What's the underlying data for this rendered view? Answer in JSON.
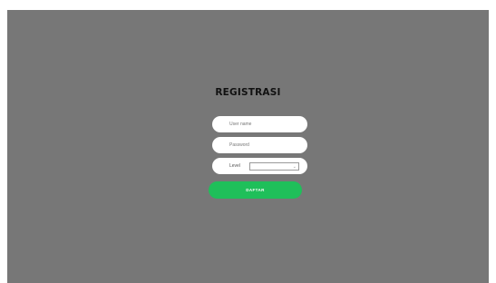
{
  "form": {
    "title": "REGISTRASI",
    "username": {
      "placeholder": "User name",
      "value": ""
    },
    "password": {
      "placeholder": "Password",
      "value": ""
    },
    "level": {
      "label": "Level",
      "selected": ""
    },
    "submit_label": "DAFTAR"
  },
  "colors": {
    "background": "#777777",
    "field": "#ffffff",
    "button": "#1fbf5a"
  }
}
